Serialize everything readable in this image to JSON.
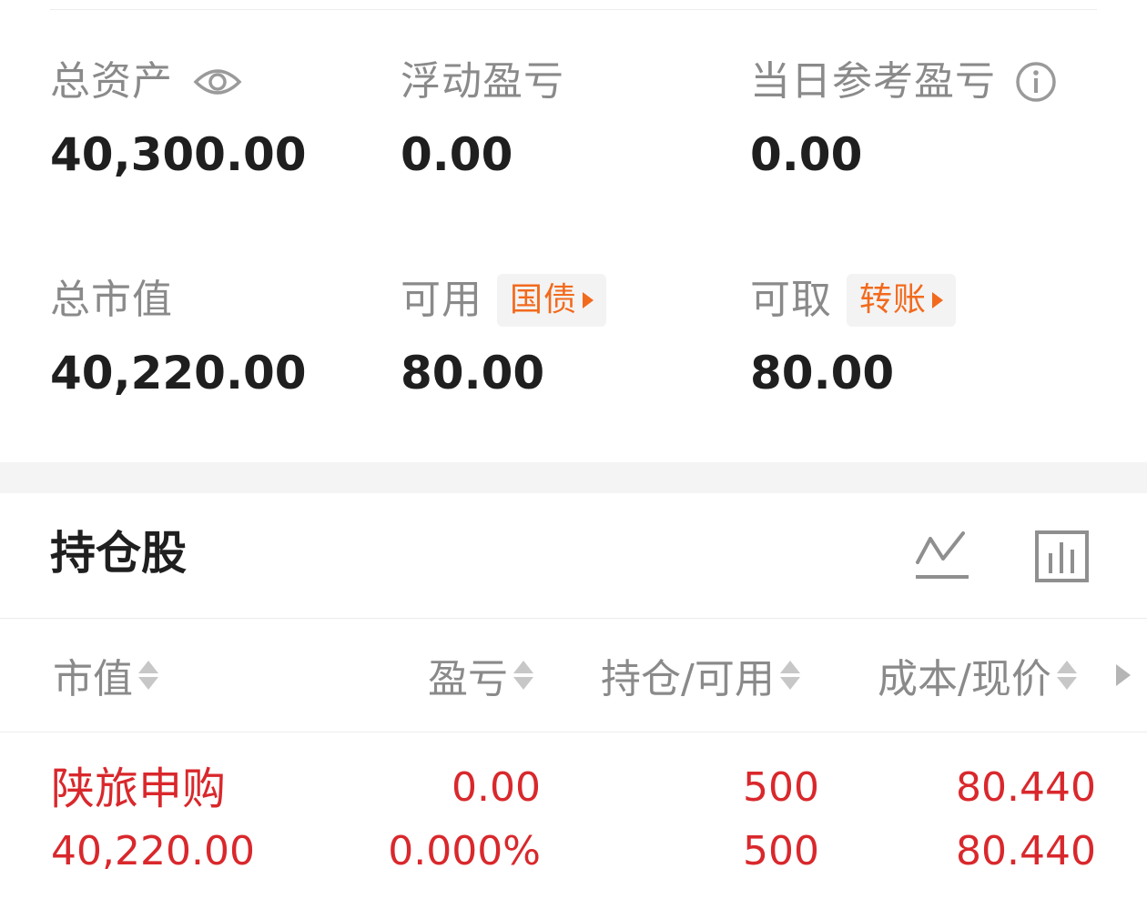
{
  "summary": {
    "total_assets": {
      "label": "总资产",
      "value": "40,300.00"
    },
    "floating_pnl": {
      "label": "浮动盈亏",
      "value": "0.00"
    },
    "daily_ref_pnl": {
      "label": "当日参考盈亏",
      "value": "0.00"
    },
    "total_market_value": {
      "label": "总市值",
      "value": "40,220.00"
    },
    "available": {
      "label": "可用",
      "value": "80.00",
      "tag": "国债"
    },
    "withdrawable": {
      "label": "可取",
      "value": "80.00",
      "tag": "转账"
    }
  },
  "holdings": {
    "title": "持仓股",
    "columns": [
      {
        "label": "市值"
      },
      {
        "label": "盈亏"
      },
      {
        "label": "持仓/可用"
      },
      {
        "label": "成本/现价"
      }
    ],
    "rows": [
      {
        "name": "陕旅申购",
        "market_value": "40,220.00",
        "pnl": "0.00",
        "pnl_pct": "0.000%",
        "position": "500",
        "available": "500",
        "cost": "80.440",
        "price": "80.440"
      }
    ]
  },
  "colors": {
    "accent_orange": "#f26a1d",
    "loss_profit_red": "#d9282c",
    "label_gray": "#8a8a8a",
    "value_dark": "#1f1f1f"
  },
  "icons": [
    "eye-icon",
    "info-icon",
    "trend-chart-icon",
    "bar-chart-icon",
    "sort-icon",
    "triangle-right-icon"
  ]
}
